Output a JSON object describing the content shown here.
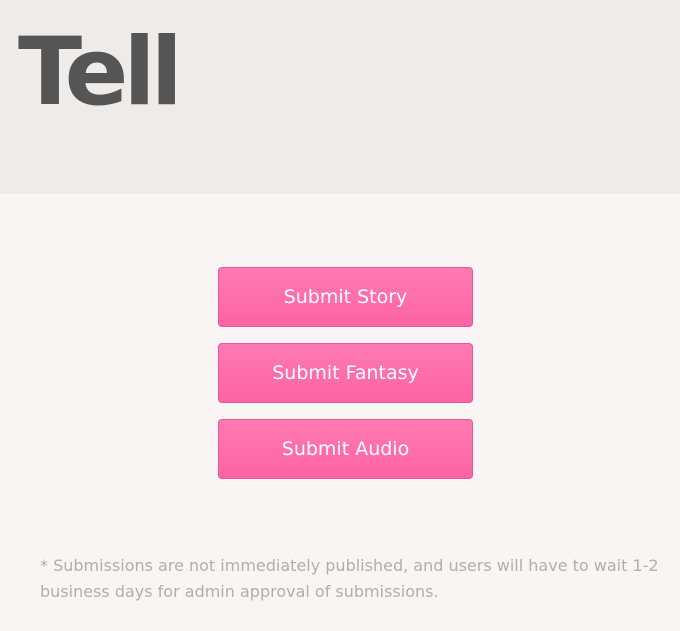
{
  "header": {
    "logo_text": "Tell"
  },
  "actions": {
    "submit_story": "Submit Story",
    "submit_fantasy": "Submit Fantasy",
    "submit_audio": "Submit Audio"
  },
  "footer": {
    "note": "* Submissions are not immediately published, and users will have to wait 1-2 business days for admin approval of submissions."
  },
  "colors": {
    "header_background": "#efebe8",
    "page_background": "#f8f5f4",
    "button_pink": "#fd6fab",
    "logo_gray": "#555555",
    "note_gray": "#b3aeac"
  }
}
